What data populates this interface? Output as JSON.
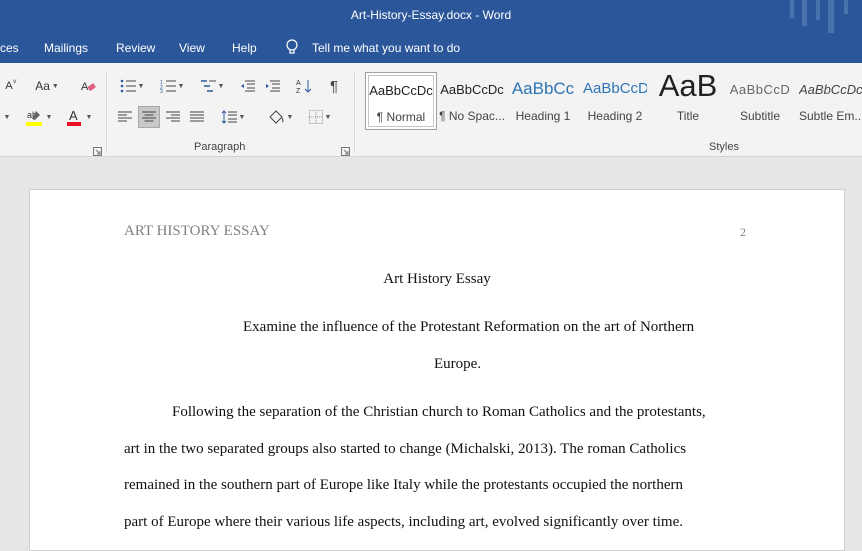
{
  "window": {
    "title": "Art-History-Essay.docx  -  Word"
  },
  "menu": {
    "items": [
      "ces",
      "Mailings",
      "Review",
      "View",
      "Help"
    ],
    "tell_me": "Tell me what you want to do"
  },
  "ribbon": {
    "font_size_label": "Aa",
    "paragraph_label": "Paragraph",
    "styles_label": "Styles",
    "colors": {
      "highlight": "#ffff00",
      "font_color": "#e81123",
      "accent": "#2b579a"
    },
    "styles": [
      {
        "preview": "AaBbCcDc",
        "name": "¶ Normal",
        "selected": true
      },
      {
        "preview": "AaBbCcDc",
        "name": "¶ No Spac..."
      },
      {
        "preview": "AaBbCc",
        "name": "Heading 1"
      },
      {
        "preview": "AaBbCcD",
        "name": "Heading 2"
      },
      {
        "preview": "AaB",
        "name": "Title"
      },
      {
        "preview": "AaBbCcD",
        "name": "Subtitle"
      },
      {
        "preview": "AaBbCcDc",
        "name": "Subtle Em..."
      }
    ]
  },
  "document": {
    "header_left": "ART HISTORY ESSAY",
    "page_number": "2",
    "title": "Art History Essay",
    "prompt_line1": "Examine the influence of the Protestant Reformation on the art of Northern",
    "prompt_line2": "Europe.",
    "body_lines": [
      "Following the separation of the Christian church to Roman Catholics and the protestants,",
      "art in the two separated groups also started to change (Michalski, 2013). The roman Catholics",
      "remained in the southern part of Europe like Italy while the protestants occupied the northern",
      "part of Europe where their various life aspects, including art, evolved significantly over time."
    ]
  }
}
